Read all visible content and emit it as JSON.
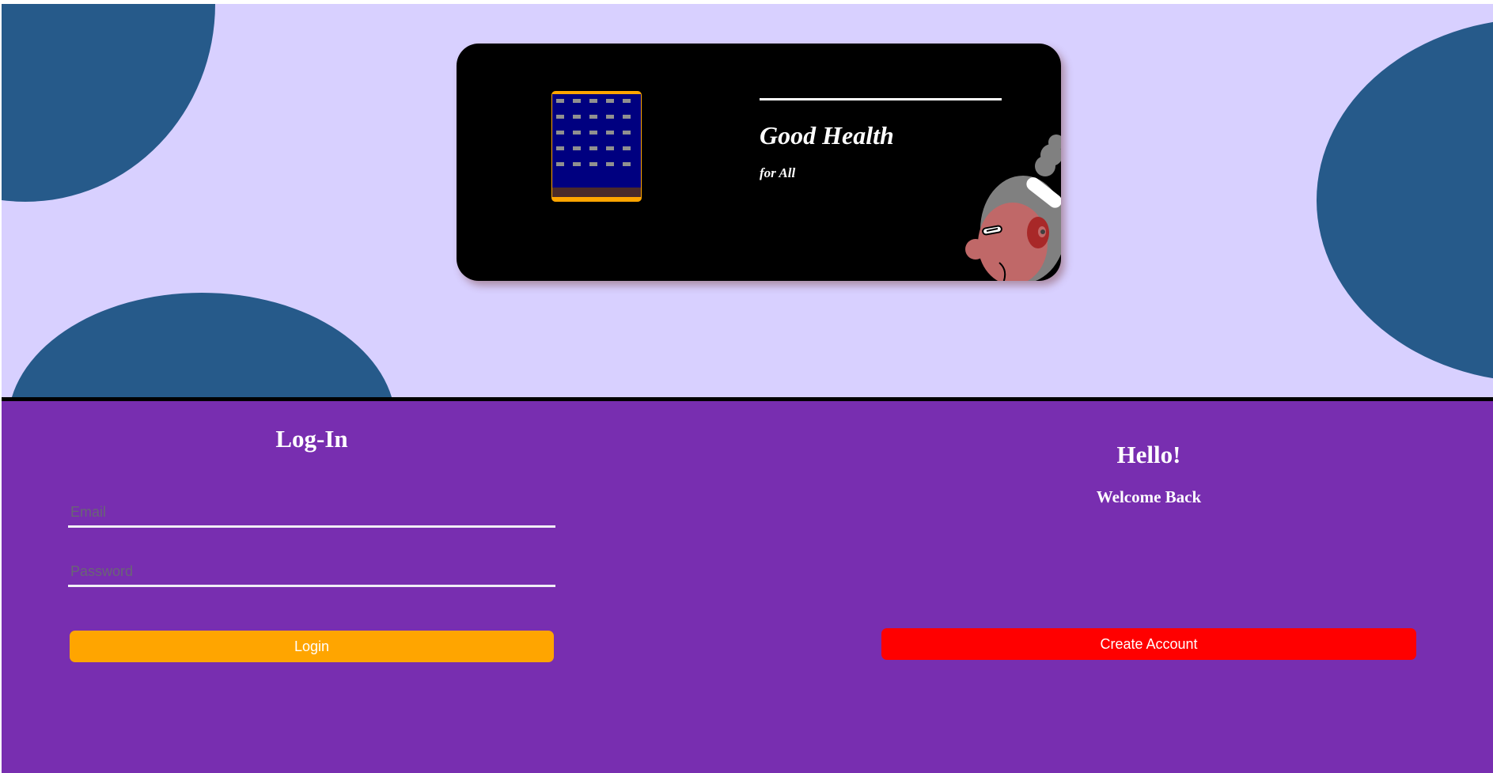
{
  "banner": {
    "title": "Good Health",
    "subtitle": "for All",
    "illustrations": [
      "building-icon",
      "person-illustration"
    ]
  },
  "login": {
    "heading": "Log-In",
    "email_placeholder": "Email",
    "password_placeholder": "Password",
    "submit_label": "Login"
  },
  "signup": {
    "heading": "Hello!",
    "subheading": "Welcome Back",
    "button_label": "Create Account"
  },
  "colors": {
    "hero_background": "#d8d0ff",
    "blob": "#265a8a",
    "bottom_background": "#782eb0",
    "login_button": "#ffa500",
    "create_button": "#ff0000",
    "banner_background": "#000000"
  }
}
